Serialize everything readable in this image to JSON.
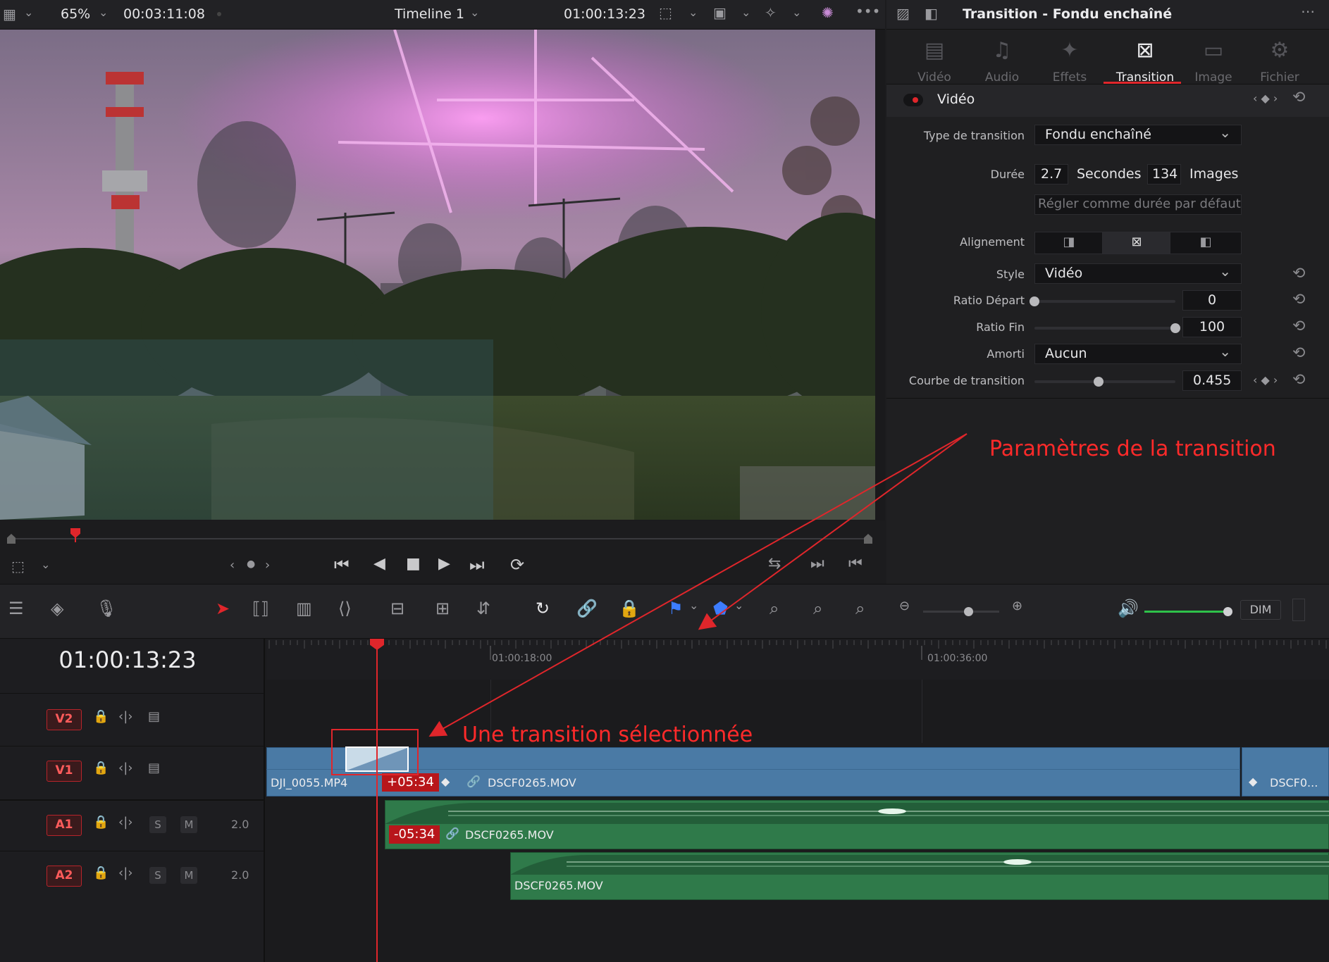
{
  "viewer_bar": {
    "zoom": "65%",
    "source_timecode": "00:03:11:08",
    "timeline_name": "Timeline 1",
    "record_timecode": "01:00:13:23"
  },
  "inspector": {
    "title": "Transition - Fondu enchaîné",
    "tabs": [
      {
        "label": "Vidéo",
        "active": false
      },
      {
        "label": "Audio",
        "active": false
      },
      {
        "label": "Effets",
        "active": false
      },
      {
        "label": "Transition",
        "active": true
      },
      {
        "label": "Image",
        "active": false
      },
      {
        "label": "Fichier",
        "active": false
      }
    ],
    "section": "Vidéo",
    "fields": {
      "type_label": "Type de transition",
      "type_value": "Fondu enchaîné",
      "duration_label": "Durée",
      "duration_seconds": "2.7",
      "seconds_unit": "Secondes",
      "duration_frames": "134",
      "frames_unit": "Images",
      "default_duration_button": "Régler comme durée par défaut",
      "alignment_label": "Alignement",
      "style_label": "Style",
      "style_value": "Vidéo",
      "ratio_start_label": "Ratio Départ",
      "ratio_start_value": "0",
      "ratio_end_label": "Ratio Fin",
      "ratio_end_value": "100",
      "ease_label": "Amorti",
      "ease_value": "Aucun",
      "curve_label": "Courbe de transition",
      "curve_value": "0.455"
    },
    "slider_levels": {
      "ratio_start": 0.0,
      "ratio_end": 1.0,
      "curve": 0.455
    }
  },
  "annotations": {
    "params": "Paramètres de la transition",
    "selected": "Une transition sélectionnée"
  },
  "timeline": {
    "timecode": "01:00:13:23",
    "ruler_marks": [
      "01:00:18:00",
      "01:00:36:00"
    ],
    "tracks": [
      {
        "name": "V2"
      },
      {
        "name": "V1"
      },
      {
        "name": "A1",
        "level": "2.0",
        "solo": "S",
        "mute": "M"
      },
      {
        "name": "A2",
        "level": "2.0",
        "solo": "S",
        "mute": "M"
      }
    ],
    "clips": {
      "v1_a": "DJI_0055.MP4",
      "v1_offset": "+05:34",
      "v1_b": "DSCF0265.MOV",
      "v1_c": "DSCF0...",
      "a1_offset": "-05:34",
      "a1": "DSCF0265.MOV",
      "a2": "DSCF0265.MOV"
    },
    "volume_button": "DIM"
  },
  "colors": {
    "accent_red": "#e0262b",
    "video_clip": "#4a7aa5",
    "audio_clip": "#2f7a4a",
    "panel": "#1f1f21"
  }
}
